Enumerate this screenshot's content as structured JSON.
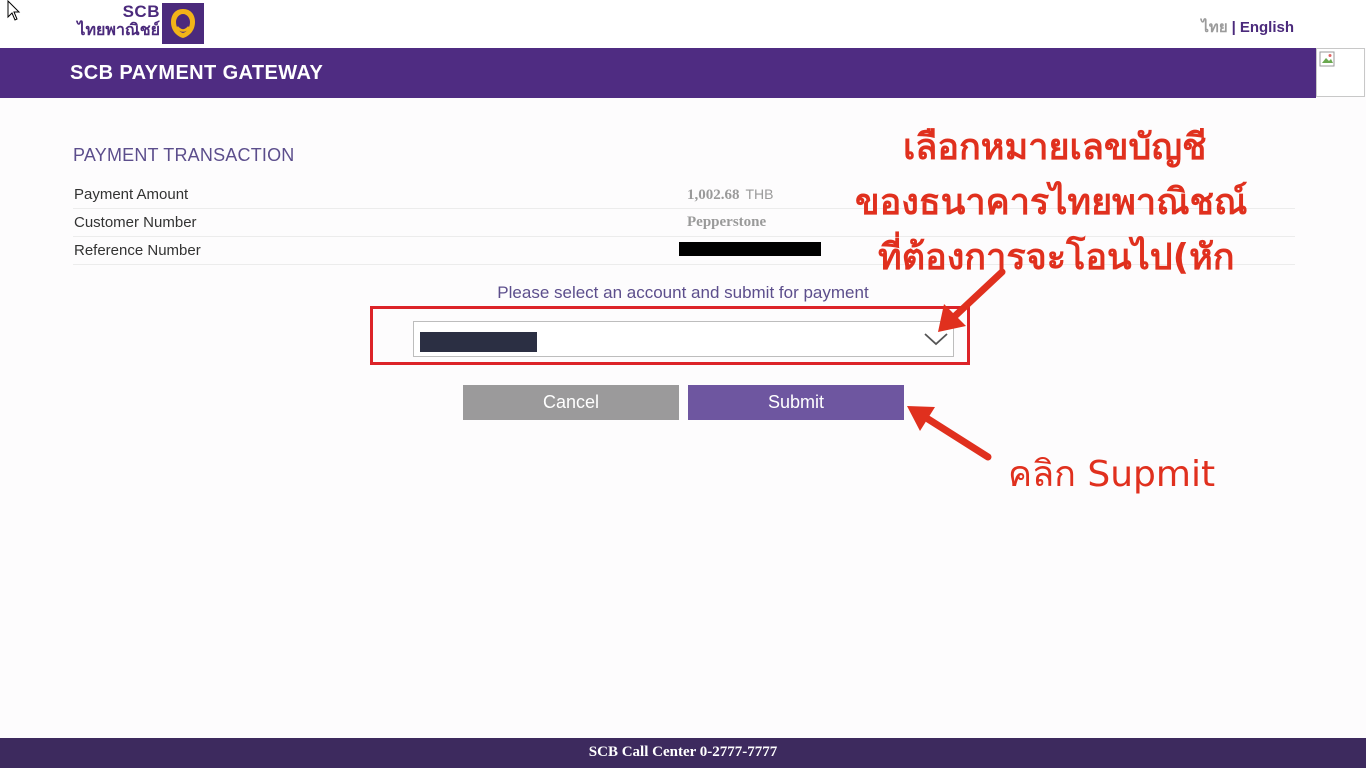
{
  "brand": {
    "name_en": "SCB",
    "name_th": "ไทยพาณิชย์",
    "color": "#4f2c82"
  },
  "language": {
    "thai": "ไทย",
    "separator": "|",
    "english": "English"
  },
  "header": {
    "title": "SCB PAYMENT GATEWAY"
  },
  "transaction": {
    "section_title": "PAYMENT TRANSACTION",
    "rows": [
      {
        "label": "Payment Amount",
        "value": "1,002.68",
        "currency": "THB"
      },
      {
        "label": "Customer Number",
        "value": "Pepperstone"
      },
      {
        "label": "Reference Number",
        "value_redacted": true
      }
    ]
  },
  "account_select": {
    "instruction": "Please select an account and submit for payment",
    "selected_redacted": true
  },
  "buttons": {
    "cancel": "Cancel",
    "submit": "Submit"
  },
  "annotations": {
    "select_note_line1": "เลือกหมายเลขบัญชี",
    "select_note_line2": "ของธนาคารไทยพาณิชณ์",
    "select_note_line3": "ที่ต้องการจะโอนไป(หัก",
    "submit_note": "คลิก Supmit",
    "color": "#e0301e"
  },
  "footer": {
    "call_center": "SCB Call Center 0-2777-7777"
  }
}
